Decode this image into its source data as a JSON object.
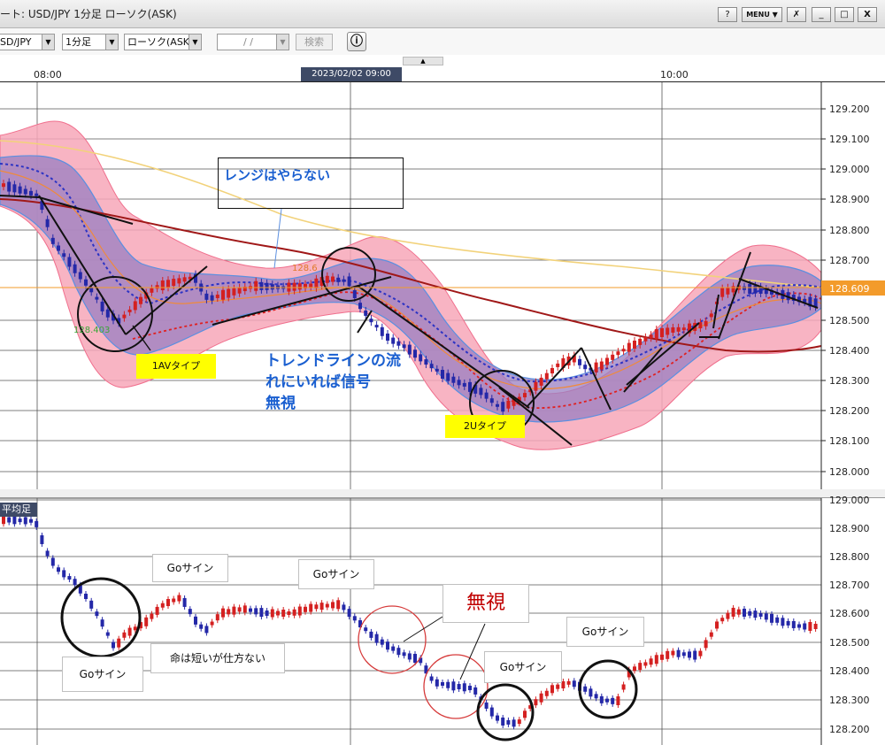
{
  "window": {
    "title": "ート: USD/JPY 1分足 ローソク(ASK)",
    "buttons": [
      "?",
      "MENU ▼",
      "✗",
      "_",
      "□",
      "X"
    ]
  },
  "toolbar": {
    "symbol": "SD/JPY",
    "timeframe": "1分足",
    "chart_type": "ローソク(ASK)",
    "date_placeholder": "/ /",
    "search_label": "検索",
    "info_label": "ⓘ"
  },
  "time_axis": {
    "labels": [
      "08:00",
      "10:00"
    ],
    "cursor": "2023/02/02 09:00"
  },
  "upper_panel": {
    "price_labels": [
      "129.200",
      "129.100",
      "129.000",
      "128.900",
      "128.800",
      "128.700",
      "128.500",
      "128.400",
      "128.300",
      "128.200",
      "128.100",
      "128.000"
    ],
    "current_price": "128.609",
    "label_high": "128.6",
    "label_low": "128.403",
    "annotations": {
      "range_note": "レンジはやらない",
      "tag_1av": "1AVタイプ",
      "tag_2u": "2Uタイプ",
      "trend_line1": "トレンドラインの流",
      "trend_line2": "れにいれば信号",
      "trend_line3": "無視"
    }
  },
  "lower_panel": {
    "tag": "平均足",
    "price_labels": [
      "129.000",
      "128.900",
      "128.800",
      "128.700",
      "128.600",
      "128.500",
      "128.400",
      "128.300",
      "128.200"
    ],
    "annotations": {
      "go1": "Goサイン",
      "go2": "Goサイン",
      "go3": "Goサイン",
      "go4": "Goサイン",
      "go5": "Goサイン",
      "life": "命は短いが仕方ない",
      "ignore": "無視"
    }
  },
  "colors": {
    "band_fill": "#f7a7b8",
    "inner_fill": "#9a7fc2",
    "bull": "#d42020",
    "bear": "#2428a8",
    "ma_dark": "#a01818",
    "ma_yellow": "#f2d27a",
    "current_price_bg": "#f39b2b"
  }
}
